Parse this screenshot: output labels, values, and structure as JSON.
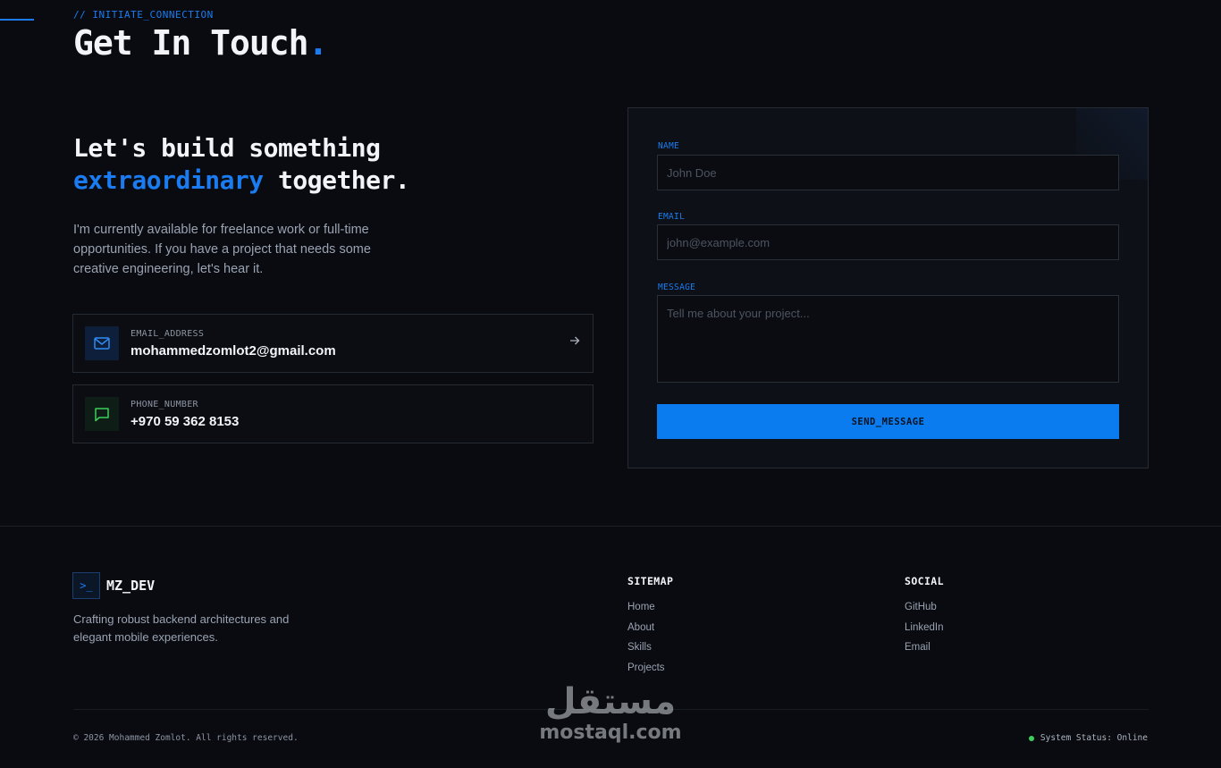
{
  "section": {
    "eyebrow": "// INITIATE_CONNECTION",
    "title": "Get In Touch",
    "title_dot": "."
  },
  "hero": {
    "line1": "Let's build something",
    "highlight": "extraordinary",
    "line2_rest": " together.",
    "intro": "I'm currently available for freelance work or full-time opportunities. If you have a project that needs some creative engineering, let's hear it."
  },
  "contacts": [
    {
      "label": "EMAIL_ADDRESS",
      "value": "mohammedzomlot2@gmail.com",
      "icon": "mail-icon"
    },
    {
      "label": "PHONE_NUMBER",
      "value": "+970 59 362 8153",
      "icon": "message-icon"
    }
  ],
  "form": {
    "name_label": "NAME",
    "name_placeholder": "John Doe",
    "email_label": "EMAIL",
    "email_placeholder": "john@example.com",
    "message_label": "MESSAGE",
    "message_placeholder": "Tell me about your project...",
    "submit_label": "SEND_MESSAGE"
  },
  "footer": {
    "brand_icon": ">_",
    "brand_name": "MZ_DEV",
    "tagline": "Crafting robust backend architectures and elegant mobile experiences.",
    "sitemap_title": "SITEMAP",
    "sitemap": [
      "Home",
      "About",
      "Skills",
      "Projects"
    ],
    "social_title": "SOCIAL",
    "social": [
      "GitHub",
      "LinkedIn",
      "Email"
    ],
    "copyright": "© 2026 Mohammed Zomlot. All rights reserved.",
    "status": "System Status: Online"
  },
  "watermark": {
    "arabic": "مستقل",
    "latin": "mostaql.com"
  },
  "colors": {
    "background": "#090b10",
    "accent": "#1a7cf0",
    "button": "#0a7cf0",
    "status_online": "#3ccf5c"
  }
}
